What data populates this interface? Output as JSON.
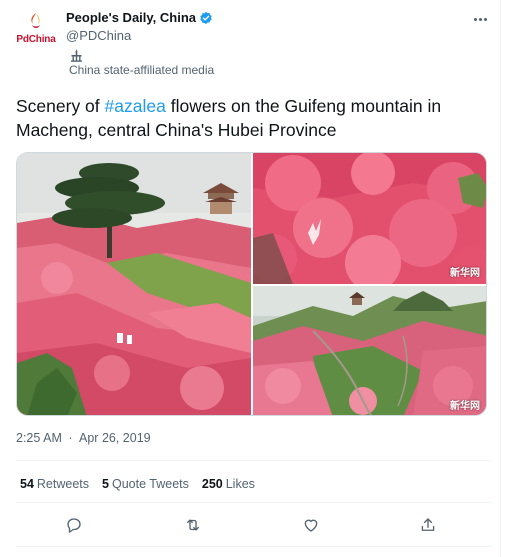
{
  "tweet": {
    "author": {
      "display_name": "People's Daily, China",
      "handle": "@PDChina",
      "verified": true,
      "avatar_brand": "PdChina",
      "label": "China state-affiliated media"
    },
    "text_before": "Scenery of ",
    "hashtag": "#azalea",
    "text_after": " flowers on the Guifeng mountain in Macheng, central China's Hubei Province",
    "photo_watermark": "新华网",
    "time": "2:25 AM",
    "separator": "·",
    "date": "Apr 26, 2019",
    "stats": [
      {
        "count": "54",
        "label": "Retweets"
      },
      {
        "count": "5",
        "label": "Quote Tweets"
      },
      {
        "count": "250",
        "label": "Likes"
      }
    ],
    "actions": [
      "reply-icon",
      "retweet-icon",
      "like-icon",
      "share-icon"
    ]
  },
  "colors": {
    "accent": "#1d9bf0",
    "text_primary": "#0f1419",
    "text_secondary": "#536471",
    "brand_red": "#c8102e"
  }
}
